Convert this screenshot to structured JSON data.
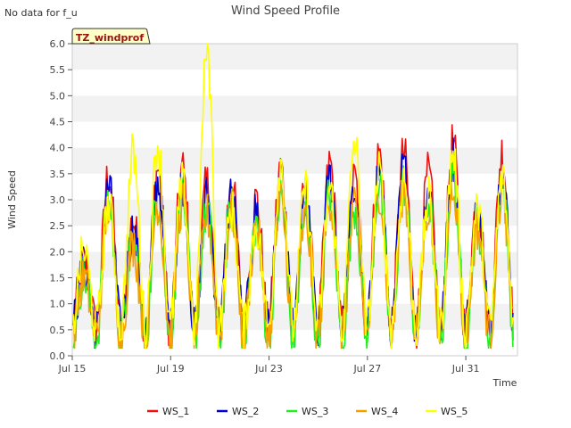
{
  "status_note": "No data for f_u",
  "chart_data": {
    "type": "line",
    "title": "Wind Speed Profile",
    "badge": "TZ_windprof",
    "xlabel": "Time",
    "ylabel": "Wind Speed",
    "ylim": [
      0.0,
      6.0
    ],
    "y_ticks": [
      "0.0",
      "0.5",
      "1.0",
      "1.5",
      "2.0",
      "2.5",
      "3.0",
      "3.5",
      "4.0",
      "4.5",
      "5.0",
      "5.5",
      "6.0"
    ],
    "x_ticks": [
      "Jul 15",
      "Jul 19",
      "Jul 23",
      "Jul 27",
      "Jul 31"
    ],
    "x_range_days": [
      "Jul 15",
      "Aug 2"
    ],
    "grid": "horizontal bands",
    "legend_position": "bottom",
    "colors": {
      "WS_1": "#ee1111",
      "WS_2": "#0000cc",
      "WS_3": "#22ee22",
      "WS_4": "#f5a000",
      "WS_5": "#ffff00"
    },
    "series": [
      {
        "name": "WS_1"
      },
      {
        "name": "WS_2"
      },
      {
        "name": "WS_3"
      },
      {
        "name": "WS_4"
      },
      {
        "name": "WS_5"
      }
    ],
    "peaks": [
      {
        "date": "Jul 15",
        "WS_1": 1.8,
        "WS_5": 2.0
      },
      {
        "date": "Jul 16",
        "WS_1": 3.5,
        "WS_5": 2.9
      },
      {
        "date": "Jul 17",
        "WS_1": 2.6,
        "WS_5": 3.9
      },
      {
        "date": "Jul 18",
        "WS_1": 3.6,
        "WS_5": 4.1
      },
      {
        "date": "Jul 19",
        "WS_1": 3.6,
        "WS_5": 3.3
      },
      {
        "date": "Jul 20",
        "WS_1": 3.3,
        "WS_5": 5.9
      },
      {
        "date": "Jul 21",
        "WS_1": 3.4,
        "WS_5": 2.8
      },
      {
        "date": "Jul 22",
        "WS_1": 3.0,
        "WS_5": 2.5
      },
      {
        "date": "Jul 23",
        "WS_1": 3.6,
        "WS_5": 3.7
      },
      {
        "date": "Jul 24",
        "WS_1": 3.2,
        "WS_5": 3.2
      },
      {
        "date": "Jul 25",
        "WS_1": 3.7,
        "WS_5": 3.2
      },
      {
        "date": "Jul 26",
        "WS_1": 3.4,
        "WS_5": 4.1
      },
      {
        "date": "Jul 27",
        "WS_1": 3.9,
        "WS_5": 3.5
      },
      {
        "date": "Jul 28",
        "WS_1": 3.9,
        "WS_5": 3.4
      },
      {
        "date": "Jul 29",
        "WS_1": 3.5,
        "WS_5": 3.0
      },
      {
        "date": "Jul 30",
        "WS_1": 4.1,
        "WS_5": 3.9
      },
      {
        "date": "Jul 31",
        "WS_1": 3.0,
        "WS_5": 2.8
      },
      {
        "date": "Aug 1",
        "WS_1": 3.9,
        "WS_5": 3.4
      }
    ]
  }
}
